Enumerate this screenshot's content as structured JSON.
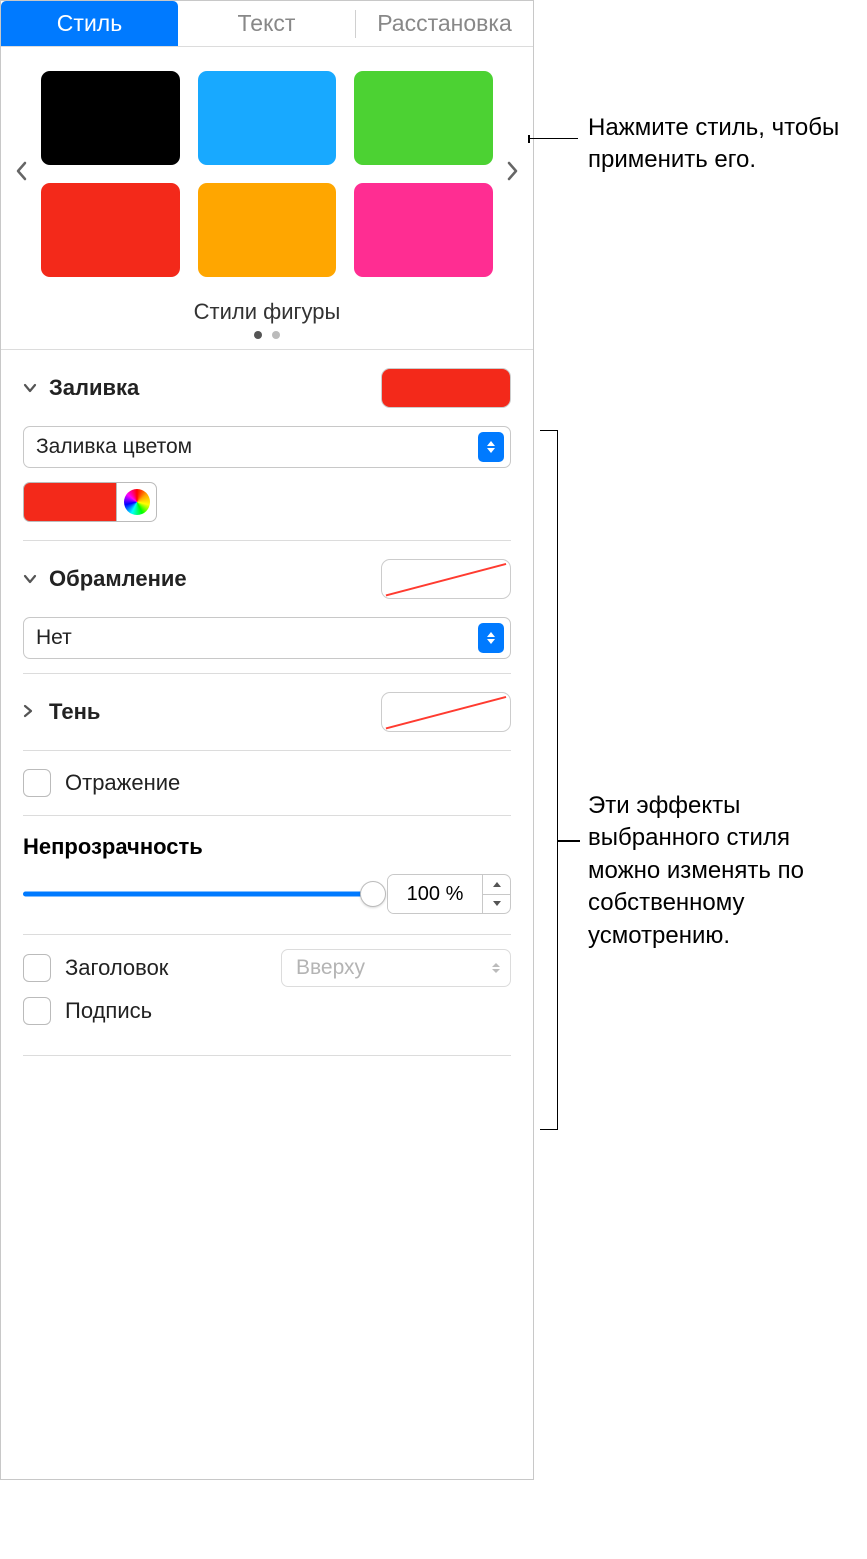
{
  "tabs": {
    "style": "Стиль",
    "text": "Текст",
    "arrange": "Расстановка"
  },
  "styles": {
    "colors": [
      "#000000",
      "#18a9ff",
      "#4cd233",
      "#f3291a",
      "#ffa600",
      "#ff2d92"
    ],
    "label": "Стили фигуры"
  },
  "fill": {
    "header": "Заливка",
    "type": "Заливка цветом",
    "color": "#f3291a"
  },
  "border": {
    "header": "Обрамление",
    "type": "Нет"
  },
  "shadow": {
    "header": "Тень"
  },
  "reflection": {
    "label": "Отражение"
  },
  "opacity": {
    "label": "Непрозрачность",
    "value": "100 %"
  },
  "titlecaption": {
    "title": "Заголовок",
    "caption": "Подпись",
    "position": "Вверху"
  },
  "callouts": {
    "c1": "Нажмите стиль, чтобы применить его.",
    "c2": "Эти эффекты выбранного стиля можно изменять по собственному усмотрению."
  }
}
